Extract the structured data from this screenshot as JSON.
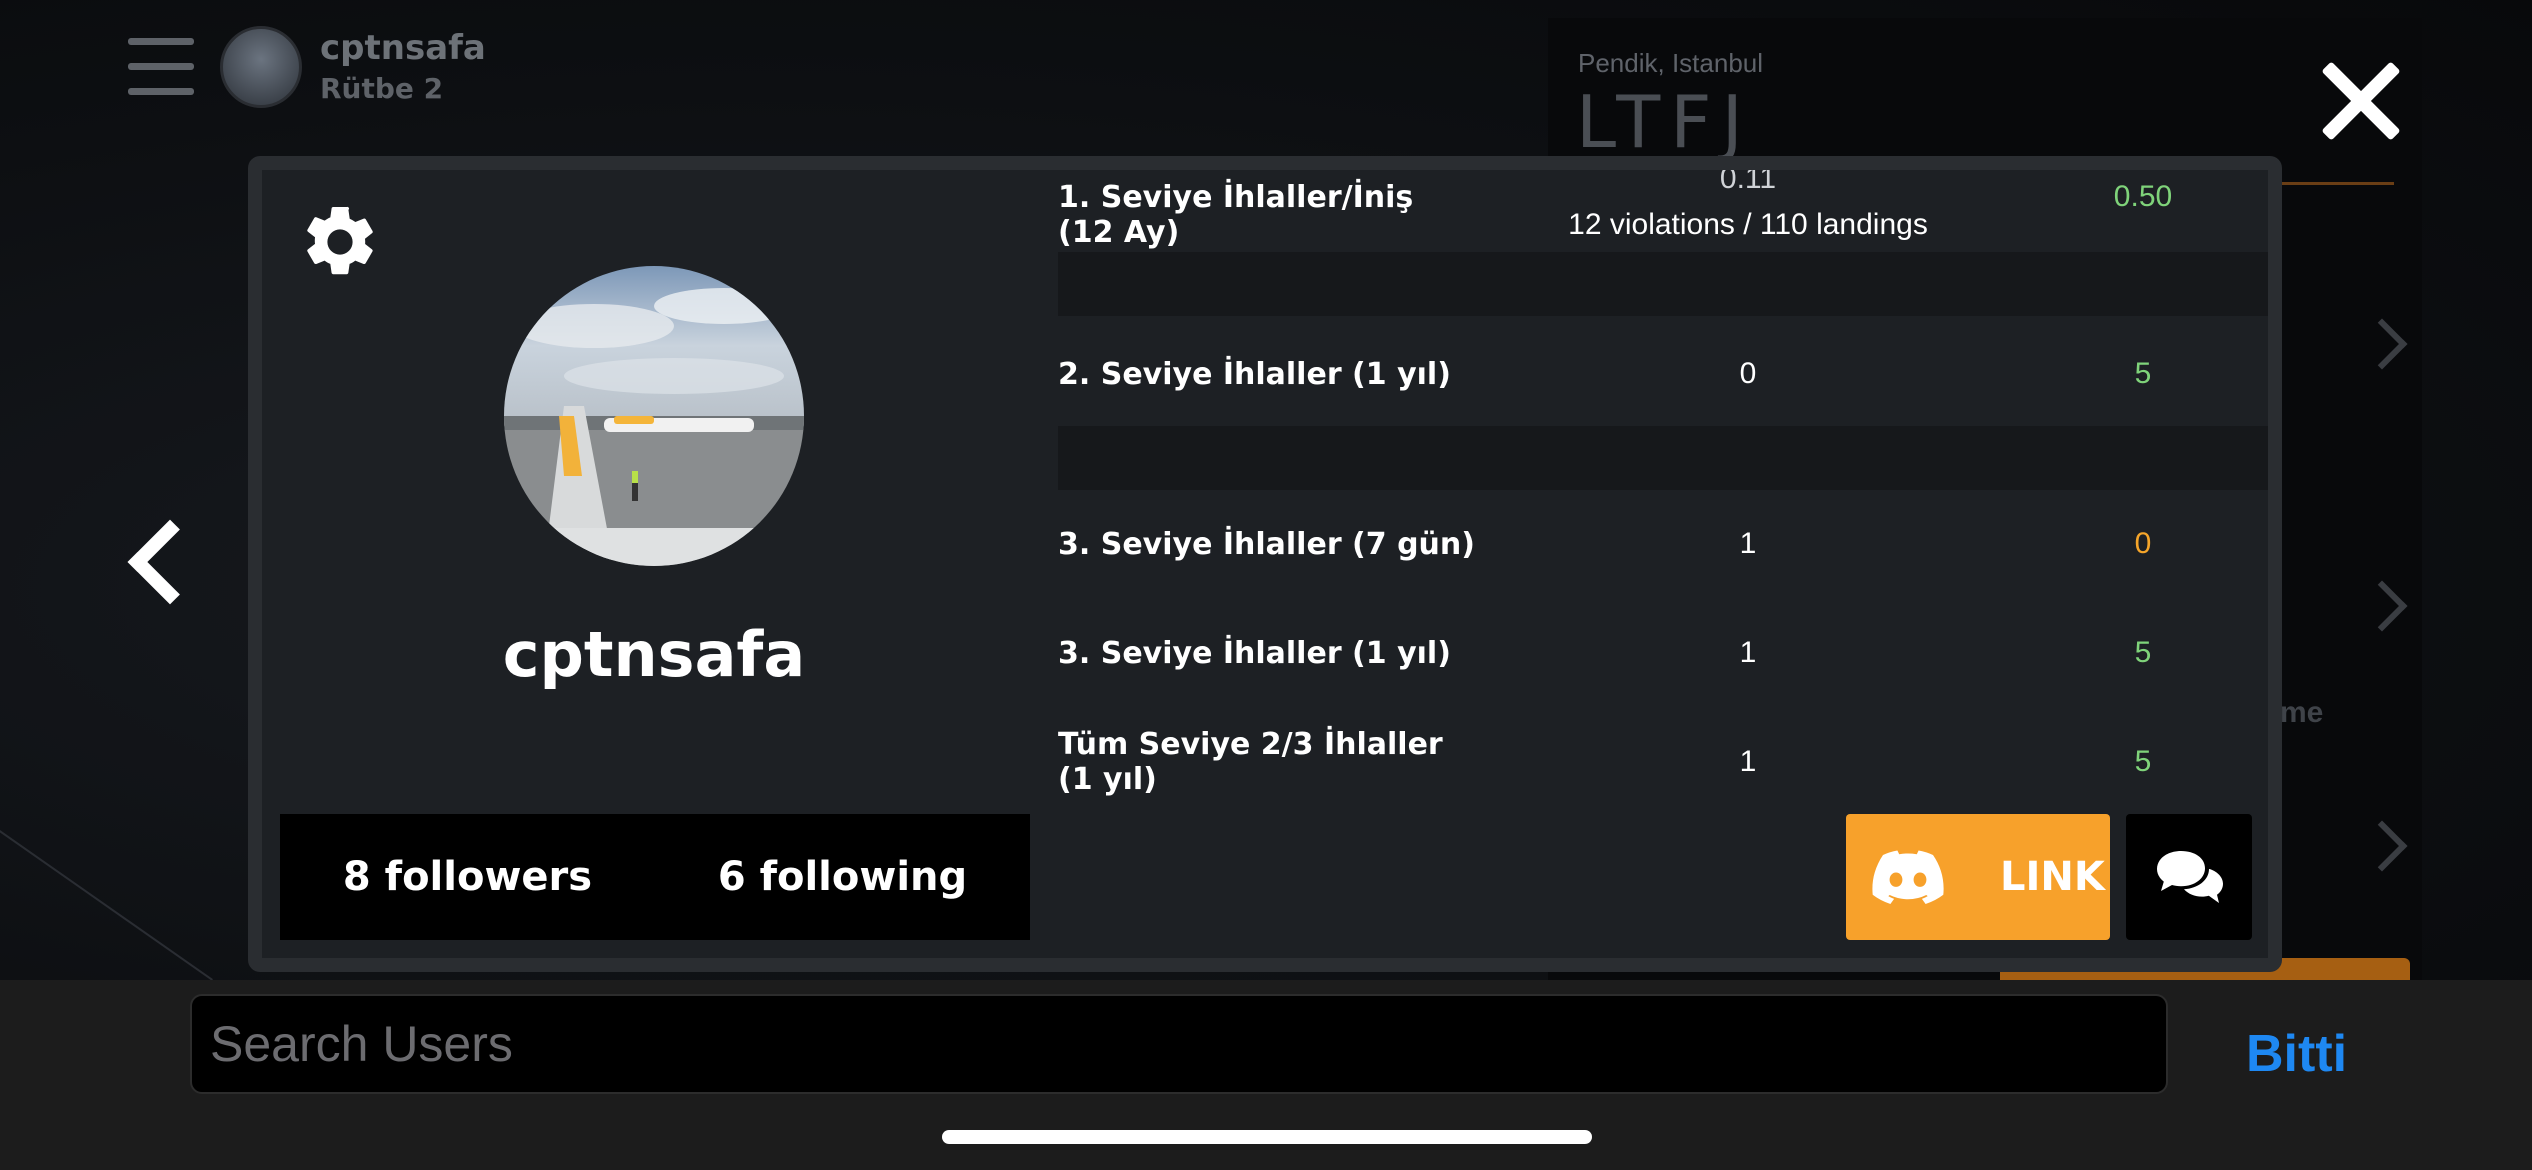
{
  "background": {
    "user": {
      "name": "cptnsafa",
      "rank": "Rütbe 2"
    },
    "airport": {
      "location": "Pendik, Istanbul",
      "code": "LTFJ"
    },
    "side_text": "me"
  },
  "profile": {
    "username": "cptnsafa",
    "followers": "8 followers",
    "following": "6 following"
  },
  "stats": {
    "rows": [
      {
        "label": "1. Seviye İhlaller/İniş (12 Ay)",
        "value_cut": "0.11",
        "value": "12 violations / 110 landings",
        "required": "0.50",
        "status": "ok"
      },
      {
        "label": "2. Seviye İhlaller (1 yıl)",
        "value": "0",
        "required": "5",
        "status": "ok"
      },
      {
        "label": "3. Seviye İhlaller (7 gün)",
        "value": "1",
        "required": "0",
        "status": "warn"
      },
      {
        "label": "3. Seviye İhlaller (1 yıl)",
        "value": "1",
        "required": "5",
        "status": "ok"
      },
      {
        "label": "Tüm Seviye 2/3 İhlaller (1 yıl)",
        "value": "1",
        "required": "5",
        "status": "ok"
      }
    ]
  },
  "actions": {
    "link_label": "LINK"
  },
  "search": {
    "placeholder": "Search Users",
    "value": "",
    "done_label": "Bitti"
  },
  "colors": {
    "accent": "#f7a12b",
    "ok": "#7fd37a",
    "warn": "#f5a52a",
    "done": "#1e88f2"
  }
}
